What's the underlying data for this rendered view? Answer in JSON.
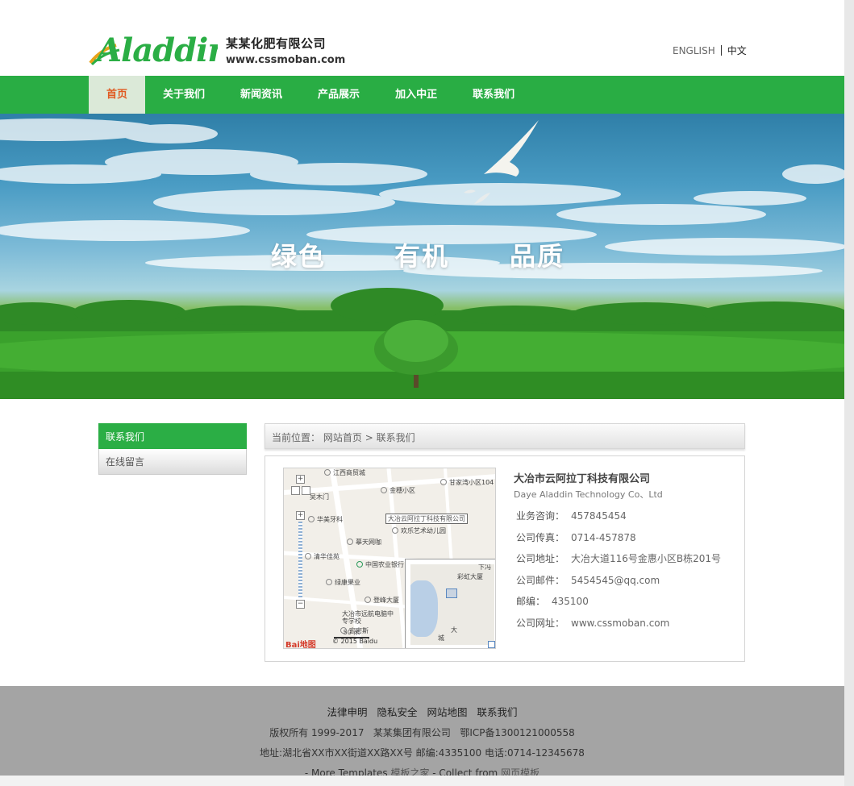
{
  "header": {
    "logo_text": "Aladdin",
    "company_name": "某某化肥有限公司",
    "company_url": "www.cssmoban.com",
    "lang_english": "ENGLISH",
    "lang_chinese": "中文"
  },
  "nav": {
    "items": [
      {
        "label": "首页",
        "active": true
      },
      {
        "label": "关于我们"
      },
      {
        "label": "新闻资讯"
      },
      {
        "label": "产品展示"
      },
      {
        "label": "加入中正"
      },
      {
        "label": "联系我们"
      }
    ]
  },
  "banner": {
    "slogans": [
      "绿色",
      "有机",
      "品质"
    ]
  },
  "sidebar": {
    "items": [
      {
        "label": "联系我们",
        "active": true
      },
      {
        "label": "在线留言"
      }
    ]
  },
  "breadcrumb": {
    "prefix": "当前位置：",
    "home": "网站首页",
    "separator": ">",
    "current": "联系我们"
  },
  "map": {
    "labels": [
      "江西商贸城",
      "甘家湾小区104",
      "金穗小区",
      "吴木门",
      "华美牙科",
      "欢乐艺术幼儿园",
      "摹天网咖",
      "中国农业银行",
      "清华佳苑",
      "彩虹大厦",
      "绿康果业",
      "登峰大厦",
      "大冶市远航电脑中专学校",
      "宏密斯",
      "下冯",
      "城",
      "大"
    ],
    "marker_alt": "大冶云阿拉丁科技有限公司",
    "scale": "50 米",
    "copyright": "© 2015 Baidu",
    "brand": "Bai地图"
  },
  "contact": {
    "company_cn": "大冶市云阿拉丁科技有限公司",
    "company_en": "Daye Aladdin Technology Co、Ltd",
    "rows": [
      {
        "key": "业务咨询：",
        "value": "457845454"
      },
      {
        "key": "公司传真：",
        "value": "0714-457878"
      },
      {
        "key": "公司地址：",
        "value": "大冶大道116号金惠小区B栋201号"
      },
      {
        "key": "公司邮件：",
        "value": "5454545@qq.com"
      },
      {
        "key": "邮编：",
        "value": "435100"
      },
      {
        "key": "公司网址：",
        "value": "www.cssmoban.com"
      }
    ]
  },
  "footer": {
    "links": [
      "法律申明",
      "隐私安全",
      "网站地图",
      "联系我们"
    ],
    "copyright": "版权所有 1999-2017   某某集团有限公司   鄂ICP备1300121000558",
    "address": "地址:湖北省XX市XX街道XX路XX号 邮编:4335100 电话:0714-12345678",
    "more_prefix": "- More Templates",
    "more_link": "模板之家",
    "collect_prefix": "- Collect from",
    "collect_link": "网页模板"
  },
  "colors": {
    "brand_green": "#29ad44",
    "nav_active_bg": "#dbe9d8",
    "nav_active_text": "#e05a22",
    "footer_bg": "#a4a4a4"
  }
}
